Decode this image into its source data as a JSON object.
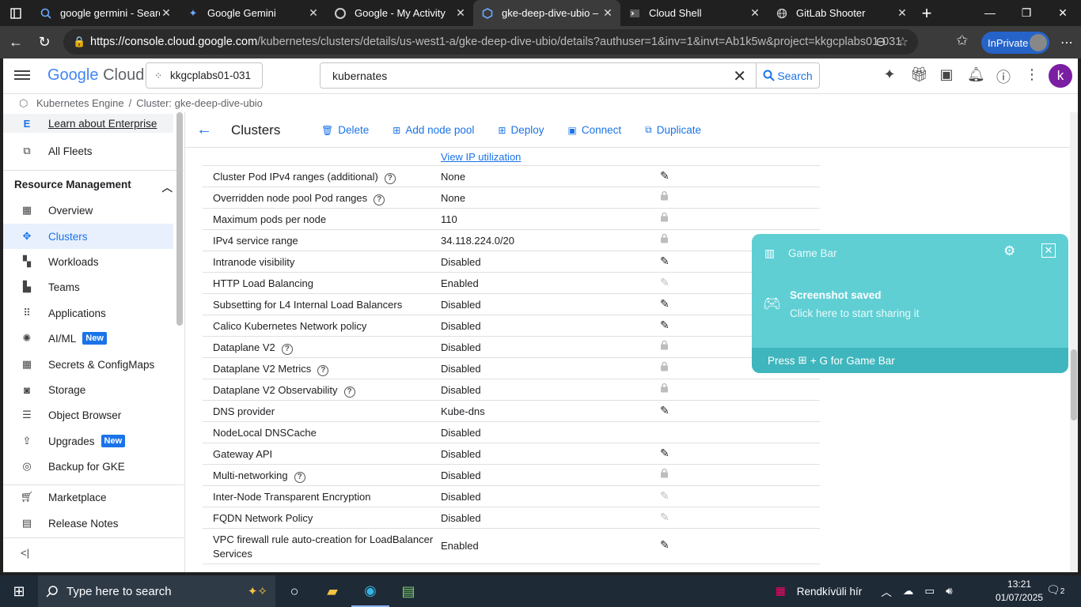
{
  "browser": {
    "tabs": [
      {
        "title": "google germini - Search",
        "icon": "search-icon"
      },
      {
        "title": "Google Gemini",
        "icon": "gemini-icon"
      },
      {
        "title": "Google - My Activity",
        "icon": "google-icon"
      },
      {
        "title": "gke-deep-dive-ubio – I",
        "icon": "kubernetes-icon",
        "active": true
      },
      {
        "title": "Cloud Shell",
        "icon": "terminal-icon"
      },
      {
        "title": "GitLab Shooter",
        "icon": "globe-icon"
      }
    ],
    "url_host": "https://console.cloud.google.com",
    "url_path": "/kubernetes/clusters/details/us-west1-a/gke-deep-dive-ubio/details?authuser=1&inv=1&invt=Ab1k5w&project=kkgcplabs01-031",
    "inprivate_label": "InPrivate"
  },
  "header": {
    "logo_google": "Google",
    "logo_cloud": "Cloud",
    "project": "kkgcplabs01-031",
    "search_value": "kubernates",
    "search_button": "Search",
    "avatar_letter": "k"
  },
  "breadcrumb": {
    "product": "Kubernetes Engine",
    "sep": "/",
    "cluster": "Cluster: gke-deep-dive-ubio"
  },
  "sidebar": {
    "enterprise": {
      "icon_text": "E",
      "label": "Learn about Enterprise"
    },
    "all_fleets": "All Fleets",
    "section_title": "Resource Management",
    "items": [
      {
        "label": "Overview",
        "icon": "overview-icon"
      },
      {
        "label": "Clusters",
        "icon": "clusters-icon",
        "active": true
      },
      {
        "label": "Workloads",
        "icon": "workloads-icon"
      },
      {
        "label": "Teams",
        "icon": "teams-icon"
      },
      {
        "label": "Applications",
        "icon": "applications-icon"
      },
      {
        "label": "AI/ML",
        "icon": "ai-ml-icon",
        "badge": "New"
      },
      {
        "label": "Secrets & ConfigMaps",
        "icon": "secrets-icon"
      },
      {
        "label": "Storage",
        "icon": "storage-icon"
      },
      {
        "label": "Object Browser",
        "icon": "object-browser-icon"
      },
      {
        "label": "Upgrades",
        "icon": "upgrades-icon",
        "badge": "New"
      },
      {
        "label": "Backup for GKE",
        "icon": "backup-icon"
      }
    ],
    "marketplace": "Marketplace",
    "release_notes": "Release Notes"
  },
  "toolbar": {
    "title": "Clusters",
    "delete": "Delete",
    "add_node_pool": "Add node pool",
    "deploy": "Deploy",
    "connect": "Connect",
    "duplicate": "Duplicate"
  },
  "partial_row_link": "View IP utilization",
  "rows": [
    {
      "key": "Cluster Pod IPv4 ranges (additional)",
      "help": true,
      "value": "None",
      "action": "edit"
    },
    {
      "key": "Overridden node pool Pod ranges",
      "help": true,
      "value": "None",
      "action": "lock"
    },
    {
      "key": "Maximum pods per node",
      "help": false,
      "value": "110",
      "action": "lock"
    },
    {
      "key": "IPv4 service range",
      "help": false,
      "value": "34.118.224.0/20",
      "action": "lock"
    },
    {
      "key": "Intranode visibility",
      "help": false,
      "value": "Disabled",
      "action": "edit"
    },
    {
      "key": "HTTP Load Balancing",
      "help": false,
      "value": "Enabled",
      "action": "edit-disabled"
    },
    {
      "key": "Subsetting for L4 Internal Load Balancers",
      "help": false,
      "value": "Disabled",
      "action": "edit"
    },
    {
      "key": "Calico Kubernetes Network policy",
      "help": false,
      "value": "Disabled",
      "action": "edit"
    },
    {
      "key": "Dataplane V2",
      "help": true,
      "value": "Disabled",
      "action": "lock"
    },
    {
      "key": "Dataplane V2 Metrics",
      "help": true,
      "value": "Disabled",
      "action": "lock"
    },
    {
      "key": "Dataplane V2 Observability",
      "help": true,
      "value": "Disabled",
      "action": "lock"
    },
    {
      "key": "DNS provider",
      "help": false,
      "value": "Kube-dns",
      "action": "edit"
    },
    {
      "key": "NodeLocal DNSCache",
      "help": false,
      "value": "Disabled",
      "action": "none"
    },
    {
      "key": "Gateway API",
      "help": false,
      "value": "Disabled",
      "action": "edit"
    },
    {
      "key": "Multi-networking",
      "help": true,
      "value": "Disabled",
      "action": "lock"
    },
    {
      "key": "Inter-Node Transparent Encryption",
      "help": false,
      "value": "Disabled",
      "action": "edit-disabled"
    },
    {
      "key": "FQDN Network Policy",
      "help": false,
      "value": "Disabled",
      "action": "edit-disabled"
    },
    {
      "key": "VPC firewall rule auto-creation for LoadBalancer",
      "key2": "Services",
      "help": false,
      "value": "Enabled",
      "action": "edit"
    }
  ],
  "gamebar": {
    "title": "Game Bar",
    "headline": "Screenshot saved",
    "subline": "Click here to start sharing it",
    "footer_pre": "Press",
    "footer_post": "+ G for Game Bar"
  },
  "taskbar": {
    "search_placeholder": "Type here to search",
    "weather": "Rendkívüli hír",
    "time": "13:21",
    "date": "01/07/2025",
    "notif_count": "2"
  }
}
